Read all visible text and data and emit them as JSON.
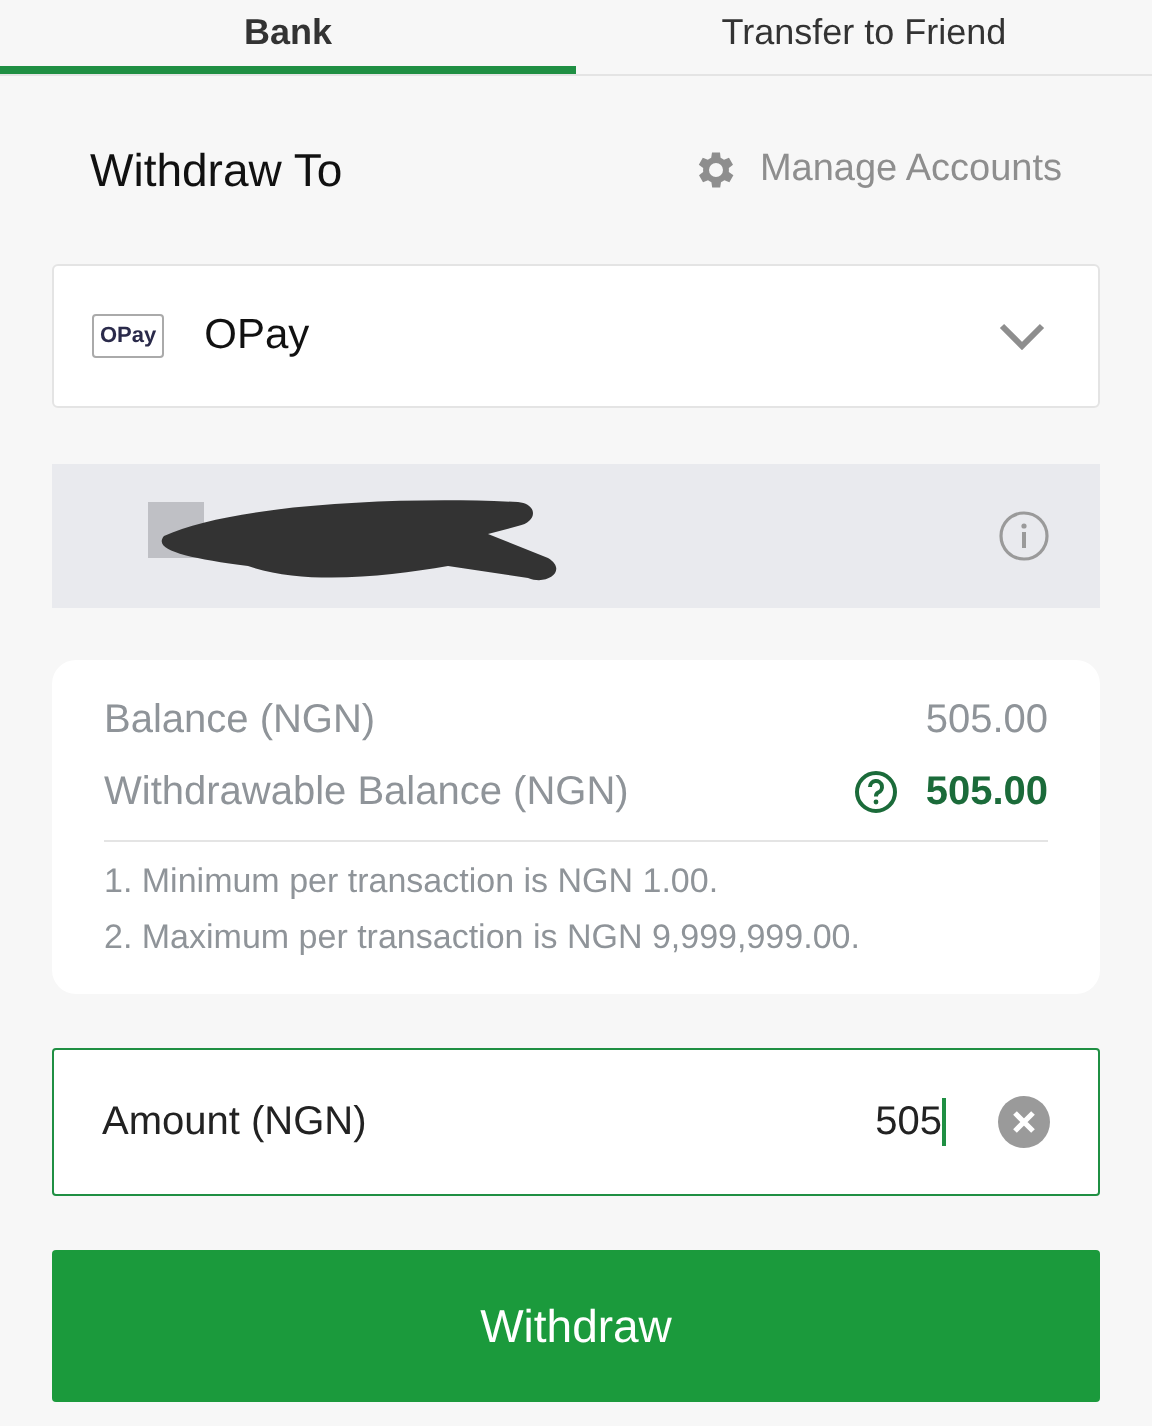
{
  "tabs": [
    {
      "label": "Bank",
      "selected": true
    },
    {
      "label": "Transfer to Friend",
      "selected": false
    }
  ],
  "heading": "Withdraw To",
  "manage_link": "Manage Accounts",
  "bank_select": {
    "logo_text": "OPay",
    "name": "OPay"
  },
  "balances": [
    {
      "label": "Balance (NGN)",
      "value": "505.00",
      "kind": "plain"
    },
    {
      "label": "Withdrawable Balance (NGN)",
      "value": "505.00",
      "kind": "help"
    }
  ],
  "rules": [
    "1. Minimum per transaction is NGN 1.00.",
    "2. Maximum per transaction is NGN 9,999,999.00."
  ],
  "amount": {
    "label": "Amount (NGN)",
    "value": "505"
  },
  "button": "Withdraw"
}
